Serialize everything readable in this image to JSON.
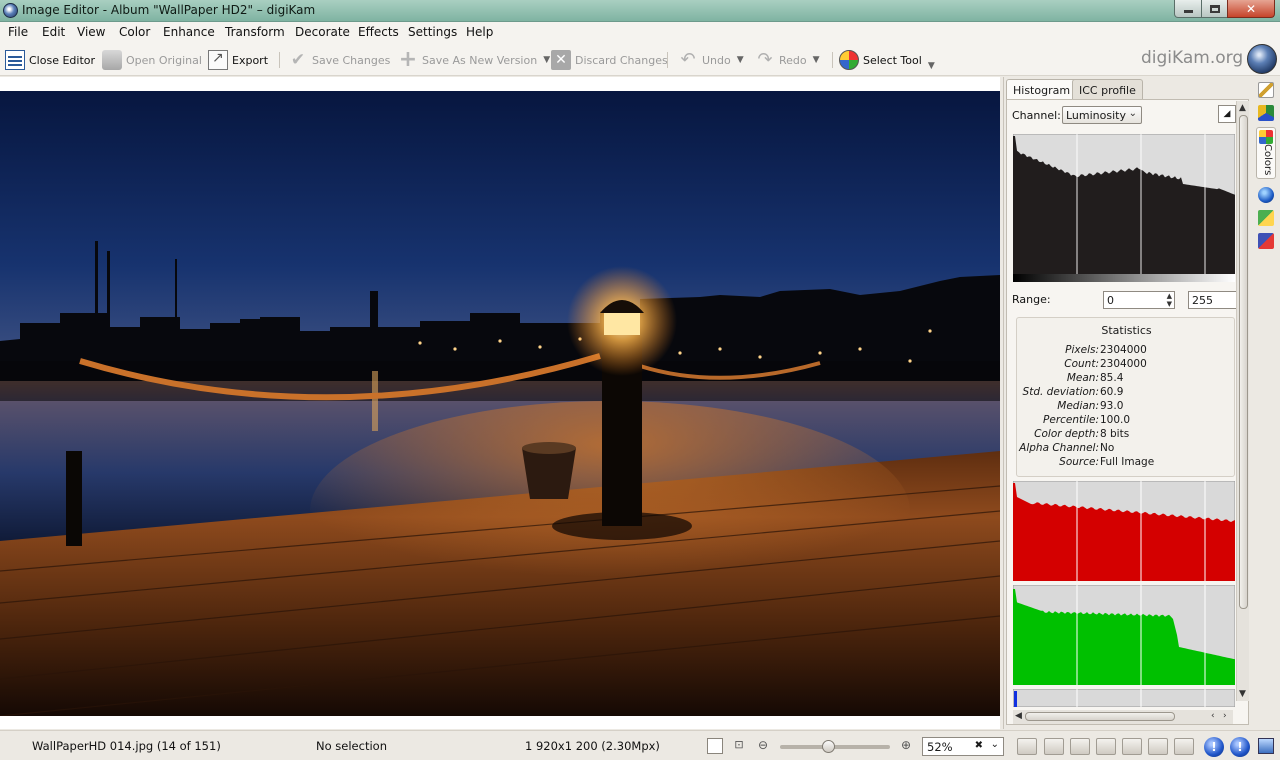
{
  "window": {
    "title": "Image Editor - Album \"WallPaper HD2\" – digiKam",
    "minimize_label": "",
    "maximize_label": "",
    "close_label": "✕"
  },
  "menubar": {
    "items": [
      {
        "label": "File"
      },
      {
        "label": "Edit"
      },
      {
        "label": "View"
      },
      {
        "label": "Color"
      },
      {
        "label": "Enhance"
      },
      {
        "label": "Transform"
      },
      {
        "label": "Decorate"
      },
      {
        "label": "Effects"
      },
      {
        "label": "Settings"
      },
      {
        "label": "Help"
      }
    ]
  },
  "toolbar": {
    "close_editor": "Close Editor",
    "open_original": "Open Original",
    "export": "Export",
    "save_changes": "Save Changes",
    "save_as_new_version": "Save As New Version",
    "discard_changes": "Discard Changes",
    "undo": "Undo",
    "redo": "Redo",
    "select_tool": "Select Tool",
    "brand": "digiKam.org"
  },
  "right_panel": {
    "tabs": [
      {
        "label": "Histogram",
        "active": true
      },
      {
        "label": "ICC profile",
        "active": false
      }
    ],
    "channel_label": "Channel:",
    "channel_value": "Luminosity",
    "range_label": "Range:",
    "range_min": "0",
    "range_max": "255",
    "statistics": {
      "title": "Statistics",
      "rows": [
        {
          "key": "Pixels:",
          "value": "2304000"
        },
        {
          "key": "Count:",
          "value": "2304000"
        },
        {
          "key": "Mean:",
          "value": "85.4"
        },
        {
          "key": "Std. deviation:",
          "value": "60.9"
        },
        {
          "key": "Median:",
          "value": "93.0"
        },
        {
          "key": "Percentile:",
          "value": "100.0"
        },
        {
          "key": "Color depth:",
          "value": "8 bits"
        },
        {
          "key": "Alpha Channel:",
          "value": "No"
        },
        {
          "key": "Source:",
          "value": "Full Image"
        }
      ]
    },
    "histogram_colors": {
      "luminosity": "#211d1d",
      "red": "#d40000",
      "green": "#00c000",
      "blue": "#1030e0",
      "background": "#d9d9d9"
    }
  },
  "side_tabs": {
    "colors_label": "Colors"
  },
  "statusbar": {
    "filename": "WallPaperHD 014.jpg (14 of 151)",
    "selection": "No selection",
    "dimensions": "1 920x1 200 (2.30Mpx)",
    "zoom": "52%",
    "zoom_fraction": 0.52
  }
}
